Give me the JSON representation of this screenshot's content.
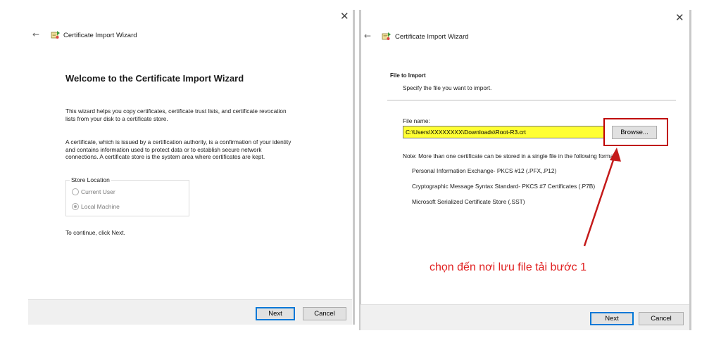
{
  "left_dialog": {
    "title": "Certificate Import Wizard",
    "heading": "Welcome to the Certificate Import Wizard",
    "intro_line1": "This wizard helps you copy certificates, certificate trust lists, and certificate revocation",
    "intro_line2": "lists from your disk to a certificate store.",
    "desc_line1": "A certificate, which is issued by a certification authority, is a confirmation of your identity",
    "desc_line2": "and contains information used to protect data or to establish secure network",
    "desc_line3": "connections. A certificate store is the system area where certificates are kept.",
    "store_location": {
      "label": "Store Location",
      "options": [
        "Current User",
        "Local Machine"
      ],
      "selected": "Local Machine"
    },
    "continue_text": "To continue, click Next.",
    "buttons": {
      "next": "Next",
      "cancel": "Cancel"
    }
  },
  "right_dialog": {
    "title": "Certificate Import Wizard",
    "section_title": "File to Import",
    "section_subtitle": "Specify the file you want to import.",
    "file_name_label": "File name:",
    "file_name_value": "C:\\Users\\XXXXXXXX\\Downloads\\Root-R3.crt",
    "browse_label": "Browse...",
    "note": "Note:  More than one certificate can be stored in a single file in the following formats:",
    "formats": [
      "Personal Information Exchange- PKCS #12 (.PFX,.P12)",
      "Cryptographic Message Syntax Standard- PKCS #7 Certificates (.P7B)",
      "Microsoft Serialized Certificate Store (.SST)"
    ],
    "buttons": {
      "next": "Next",
      "cancel": "Cancel"
    }
  },
  "annotation": {
    "text": "chọn đến nơi lưu file tải bước 1",
    "color": "#e02020"
  },
  "colors": {
    "file_field_highlight": "#ffff33",
    "annotation_red": "#c00000",
    "default_button_border": "#0078d7"
  },
  "icons": [
    "close-icon",
    "back-arrow-icon",
    "certificate-wizard-icon"
  ]
}
